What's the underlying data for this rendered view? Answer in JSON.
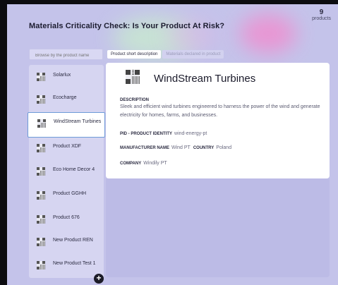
{
  "header": {
    "title": "Materials Criticality Check: Is Your Product At Risk?",
    "count": "9",
    "count_label": "products"
  },
  "search": {
    "placeholder": "Browse by the product name"
  },
  "tabs": [
    {
      "label": "Product short description",
      "active": true
    },
    {
      "label": "Materials declared in product",
      "active": false
    }
  ],
  "products": [
    {
      "label": "Solarlux"
    },
    {
      "label": "Ecocharge"
    },
    {
      "label": "WindStream Turbines",
      "selected": true
    },
    {
      "label": "Product XDF"
    },
    {
      "label": "Eco Home Decor 4"
    },
    {
      "label": "Product GGHH"
    },
    {
      "label": "Product 676"
    },
    {
      "label": "New Product REN"
    },
    {
      "label": "New Product Test 1"
    }
  ],
  "add_button": "+",
  "detail": {
    "name": "WindStream Turbines",
    "description_label": "DESCRIPTION",
    "description": "Sleek and efficient wind turbines engineered to harness the power of the wind and generate electricity for homes, farms, and businesses.",
    "pid_label": "PID - PRODUCT IDENTITY",
    "pid_value": "wind-energy-pt",
    "manufacturer_label": "MANUFACTURER NAME",
    "manufacturer_value": "Wind PT",
    "country_label": "COUNTRY",
    "country_value": "Poland",
    "company_label": "COMPANY",
    "company_value": "Windily PT"
  }
}
